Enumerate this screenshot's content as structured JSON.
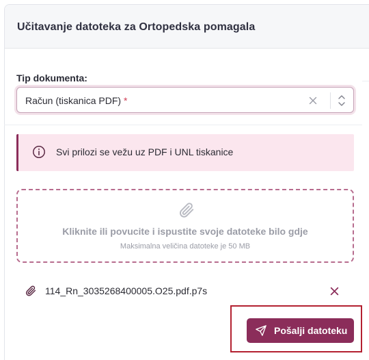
{
  "panel": {
    "title": "Učitavanje datoteka za Ortopedska pomagala"
  },
  "document_type": {
    "label": "Tip dokumenta:",
    "value": "Račun (tiskanica PDF)",
    "required_mark": "*"
  },
  "alert": {
    "icon": "info-circle-icon",
    "text": "Svi prilozi se vežu uz PDF i UNL tiskanice"
  },
  "dropzone": {
    "icon": "paperclip-icon",
    "main_text": "Kliknite ili povucite i ispustite svoje datoteke bilo gdje",
    "sub_text": "Maksimalna veličina datoteke je 50 MB"
  },
  "files": [
    {
      "name": "114_Rn_3035268400005.O25.pdf.p7s",
      "icon": "paperclip-icon",
      "remove_icon": "close-icon"
    }
  ],
  "actions": {
    "send_label": "Pošalji datoteku",
    "send_icon": "send-icon"
  },
  "colors": {
    "accent": "#8b2d5a",
    "alert_bg": "#fbe6ee",
    "dropzone_border": "#b76c8e",
    "highlight_border": "#b32030",
    "required": "#d03d55"
  }
}
